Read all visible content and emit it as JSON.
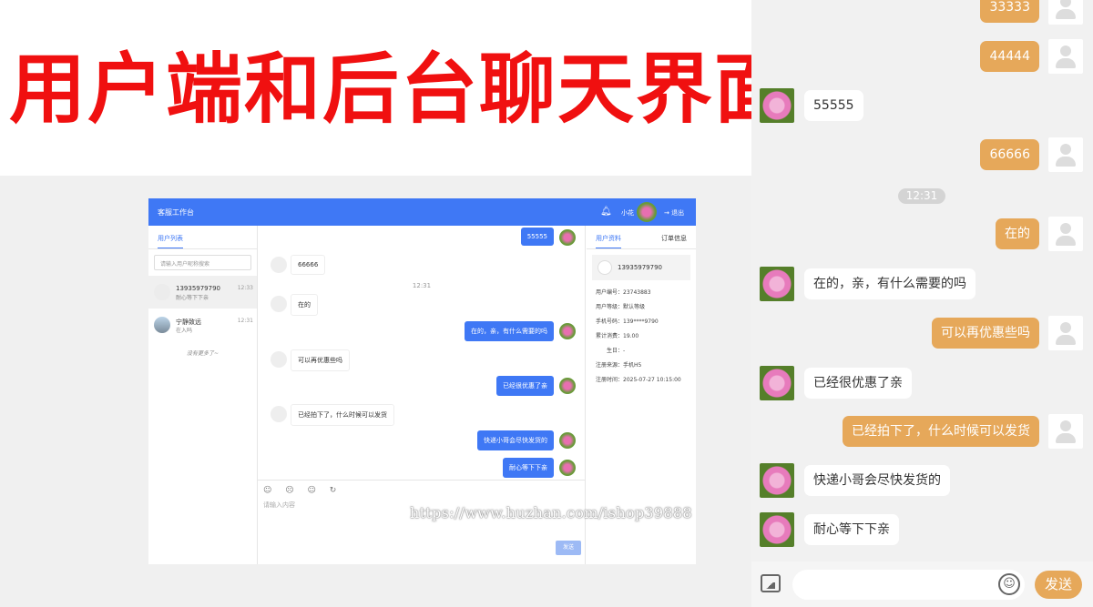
{
  "banner": {
    "title": "用户端和后台聊天界面"
  },
  "admin": {
    "title": "客服工作台",
    "agent_name": "小花",
    "logout": "→ 退出",
    "left_tab": "用户列表",
    "search_placeholder": "请输入用户昵称搜索",
    "users": [
      {
        "name": "13935979790",
        "msg": "耐心等下下亲",
        "time": "12:33"
      },
      {
        "name": "宁静致远",
        "msg": "在入吗",
        "time": "12:31"
      }
    ],
    "no_more": "没有更多了~",
    "messages": [
      {
        "side": "r",
        "text": "55555"
      },
      {
        "side": "l",
        "text": "66666"
      },
      {
        "side": "time",
        "text": "12:31"
      },
      {
        "side": "l",
        "text": "在的"
      },
      {
        "side": "r",
        "text": "在的，亲，有什么需要的吗"
      },
      {
        "side": "l",
        "text": "可以再优惠些吗"
      },
      {
        "side": "r",
        "text": "已经很优惠了亲"
      },
      {
        "side": "l",
        "text": "已经拍下了，什么时候可以发货"
      },
      {
        "side": "r",
        "text": "快递小哥会尽快发货的"
      },
      {
        "side": "r",
        "text": "耐心等下下亲"
      }
    ],
    "toolbar_icons": "☺ ☹ ☺ ↻",
    "input_placeholder": "请输入内容",
    "send_label": "发送",
    "right_tabs": [
      "用户资料",
      "订单信息"
    ],
    "profile": {
      "phone": "13935979790",
      "rows": [
        "用户编号：23743883",
        "用户等级：默认等级",
        "手机号码：139****9790",
        "累计消费：19.00",
        "生日：-",
        "注册来源：手机H5",
        "注册时间：2025-07-27 10:15:00"
      ]
    }
  },
  "mobile": {
    "messages": [
      {
        "side": "r",
        "text": "33333"
      },
      {
        "side": "r",
        "text": "44444"
      },
      {
        "side": "l",
        "text": "55555"
      },
      {
        "side": "r",
        "text": "66666"
      },
      {
        "side": "r",
        "text": "在的"
      },
      {
        "side": "l",
        "text": "在的，亲，有什么需要的吗"
      },
      {
        "side": "r",
        "text": "可以再优惠些吗"
      },
      {
        "side": "l",
        "text": "已经很优惠了亲"
      },
      {
        "side": "r",
        "text": "已经拍下了，什么时候可以发货"
      },
      {
        "side": "l",
        "text": "快递小哥会尽快发货的"
      },
      {
        "side": "l",
        "text": "耐心等下下亲"
      }
    ],
    "time": "12:31",
    "send_label": "发送",
    "emoji": "☺"
  },
  "watermark": "https://www.huzhan.com/ishop39888",
  "colors": {
    "admin_blue": "#3f78f5",
    "mobile_orange": "#e6a85a",
    "banner_red": "#f01010"
  }
}
